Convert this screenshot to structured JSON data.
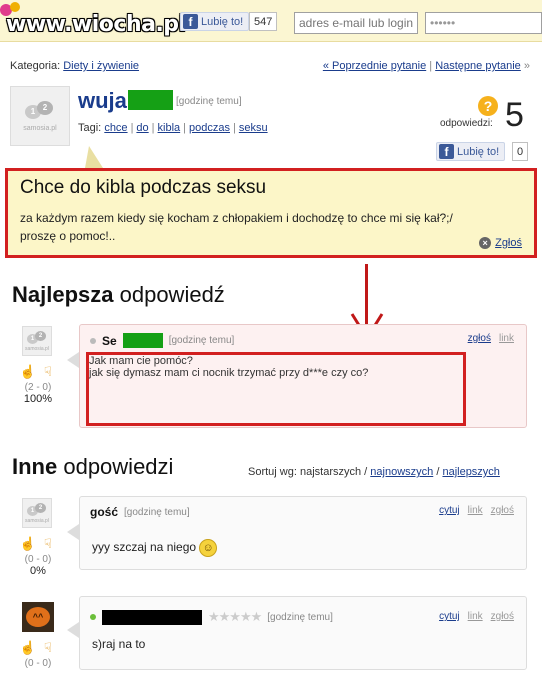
{
  "site": {
    "logo": "www.wiocha.pl",
    "like_label": "Lubię to!",
    "like_count": "547",
    "email_placeholder": "adres e-mail lub login",
    "password_value": "••••••"
  },
  "category": {
    "label": "Kategoria:",
    "name": "Diety i żywienie",
    "prev": "« Poprzednie pytanie",
    "sep": "|",
    "next": "Następne pytanie",
    "next_arrow": "»"
  },
  "question": {
    "avatar_brand": "samosia.pl",
    "username": "wuja",
    "time": "[godzinę temu]",
    "tags_label": "Tagi:",
    "tags": [
      "chce",
      "do",
      "kibla",
      "podczas",
      "seksu"
    ],
    "answers_label": "odpowiedzi:",
    "answers_count": "5",
    "like_label": "Lubię to!",
    "like_count": "0",
    "title": "Chce do kibla podczas seksu",
    "body_line1": "za każdym razem kiedy się kocham z chłopakiem i dochodzę to chce mi się kał?;/",
    "body_line2": "proszę o pomoc!..",
    "report": "Zgłoś"
  },
  "best": {
    "heading_bold": "Najlepsza",
    "heading_rest": " odpowiedź",
    "username": "Se",
    "time": "[godzinę temu]",
    "report": "zgłoś",
    "link": "link",
    "line1": "Jak mam cie pomóc?",
    "line2": "jak się dymasz mam ci nocnik trzymać przy d***e czy co?",
    "votes": "(2 - 0)",
    "percent": "100%"
  },
  "others": {
    "heading_bold": "Inne",
    "heading_rest": " odpowiedzi",
    "sort_label": "Sortuj wg: najstarszych /",
    "sort_newest": "najnowszych",
    "sort_sep": "/",
    "sort_best": "najlepszych",
    "items": [
      {
        "username": "gość",
        "time": "[godzinę temu]",
        "quote": "cytuj",
        "link": "link",
        "report": "zgłoś",
        "text": "yyy szczaj na niego",
        "votes": "(0 - 0)",
        "percent": "0%"
      },
      {
        "username": "",
        "time": "[godzinę temu]",
        "quote": "cytuj",
        "link": "link",
        "report": "zgłoś",
        "text": "s)raj na to",
        "votes": "(0 - 0)",
        "stars": "★★★★★"
      }
    ]
  },
  "colors": {
    "accent_red": "#d22020",
    "link_blue": "#1a3c8c",
    "censor_green": "#15a015"
  }
}
